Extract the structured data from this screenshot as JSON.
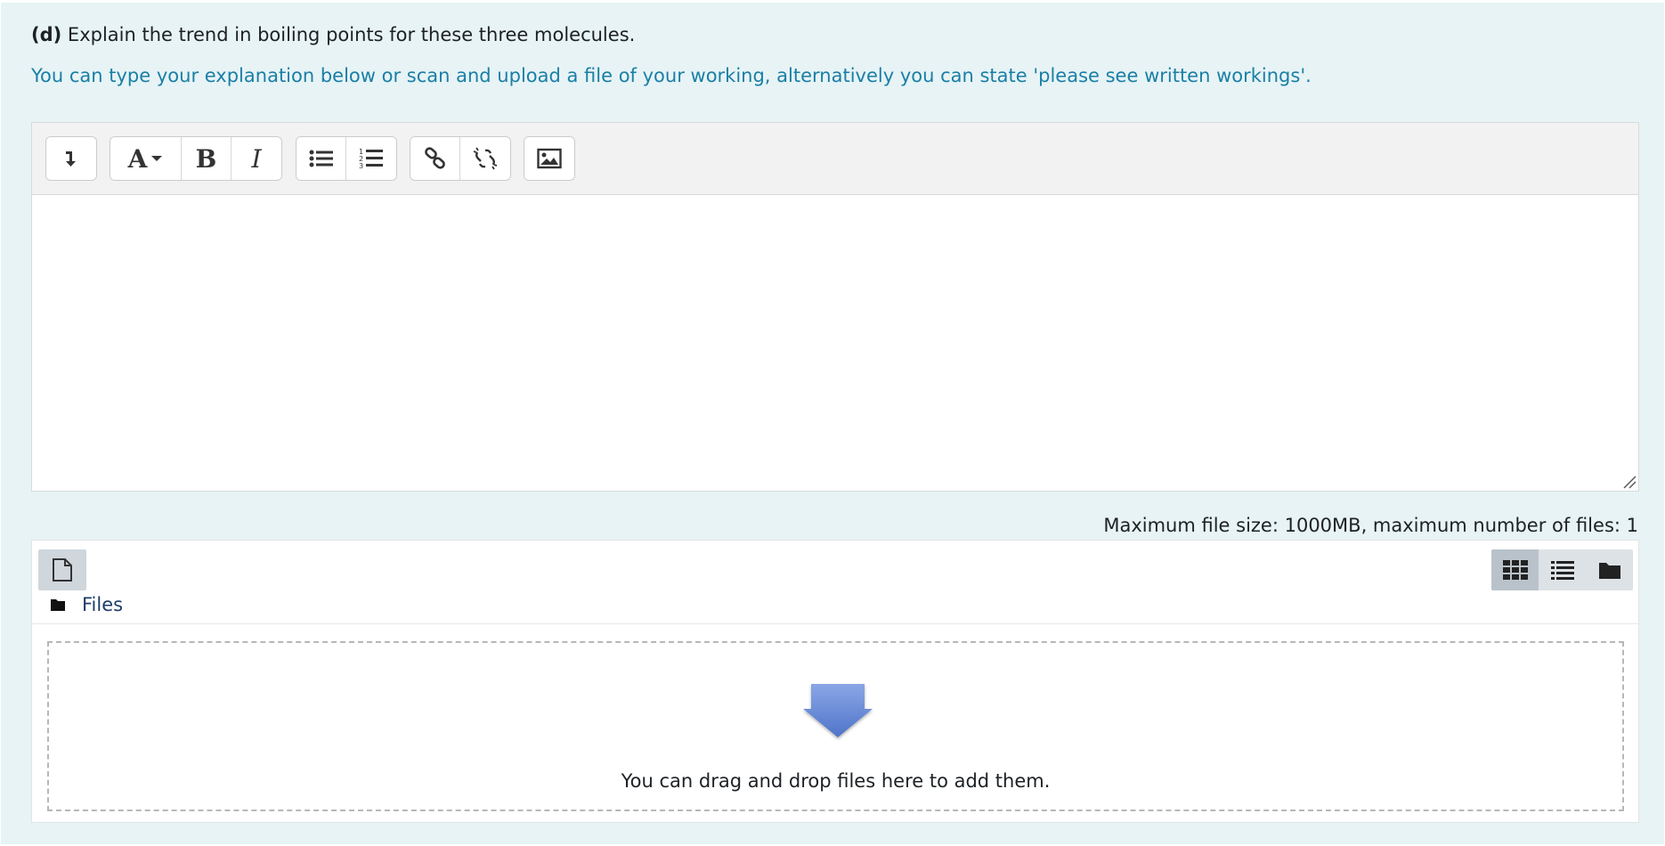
{
  "question": {
    "label": "(d)",
    "text": "Explain the trend in boiling points for these three molecules.",
    "instruction": "You can type your explanation below or scan and upload a file of your working, alternatively you can state 'please see written workings'."
  },
  "editor": {
    "toolbar_icons": [
      "show-more-icon",
      "font-style-icon",
      "bold-icon",
      "italic-icon",
      "unordered-list-icon",
      "ordered-list-icon",
      "link-icon",
      "unlink-icon",
      "image-icon"
    ],
    "bold_glyph": "B",
    "italic_glyph": "I",
    "font_glyph": "A",
    "content": ""
  },
  "file_manager": {
    "max_info": "Maximum file size: 1000MB, maximum number of files: 1",
    "folder_label": "Files",
    "drop_text": "You can drag and drop files here to add them.",
    "active_view": "icons"
  },
  "colors": {
    "background": "#e7f3f5",
    "instruction_text": "#1a7fa5",
    "toolbar_bg": "#f2f2f2",
    "drop_arrow": "#6b8fd6"
  }
}
